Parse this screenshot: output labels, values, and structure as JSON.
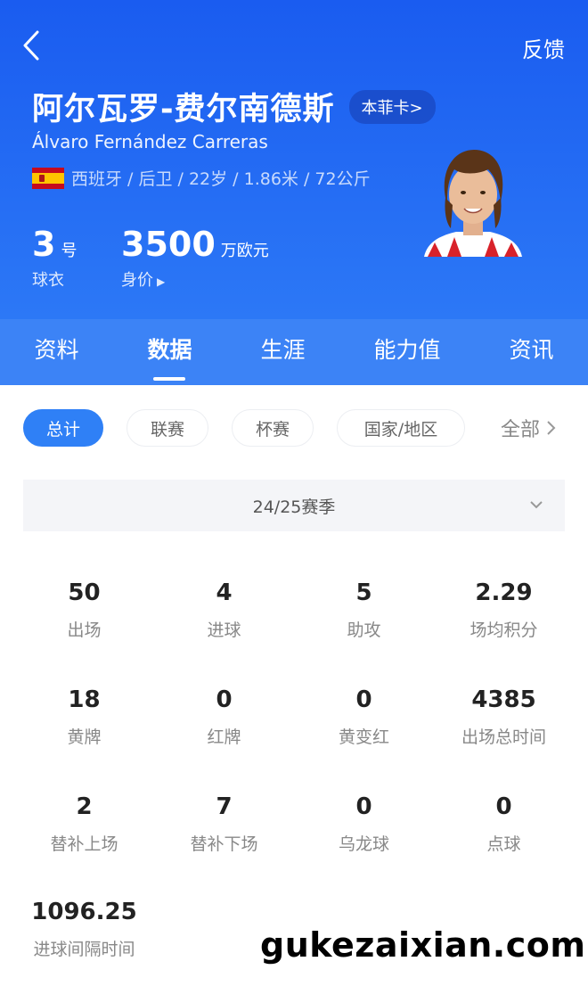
{
  "header": {
    "feedback_label": "反馈",
    "name_cn": "阿尔瓦罗-费尔南德斯",
    "card_label": "本菲卡>",
    "name_en": "Álvaro Fernández Carreras",
    "info": "西班牙 / 后卫 / 22岁 / 1.86米 / 72公斤",
    "jersey_number": "3",
    "jersey_unit": "号",
    "jersey_label": "球衣",
    "market_value": "3500",
    "market_unit": "万欧元",
    "market_label": "身价"
  },
  "tabs": [
    "资料",
    "数据",
    "生涯",
    "能力值",
    "资讯"
  ],
  "active_tab": "数据",
  "filters": [
    "总计",
    "联赛",
    "杯赛",
    "国家/地区"
  ],
  "filter_all": "全部",
  "season": "24/25赛季",
  "stats": [
    {
      "value": "50",
      "label": "出场"
    },
    {
      "value": "4",
      "label": "进球"
    },
    {
      "value": "5",
      "label": "助攻"
    },
    {
      "value": "2.29",
      "label": "场均积分"
    },
    {
      "value": "18",
      "label": "黄牌"
    },
    {
      "value": "0",
      "label": "红牌"
    },
    {
      "value": "0",
      "label": "黄变红"
    },
    {
      "value": "4385",
      "label": "出场总时间"
    },
    {
      "value": "2",
      "label": "替补上场"
    },
    {
      "value": "7",
      "label": "替补下场"
    },
    {
      "value": "0",
      "label": "乌龙球"
    },
    {
      "value": "0",
      "label": "点球"
    },
    {
      "value": "1096.25",
      "label": "进球间隔时间"
    }
  ],
  "watermark": "gukezaixian.com",
  "colors": {
    "header": "#2468f2",
    "tabbar": "#3c83f6",
    "chip_active": "#2f80f6"
  }
}
